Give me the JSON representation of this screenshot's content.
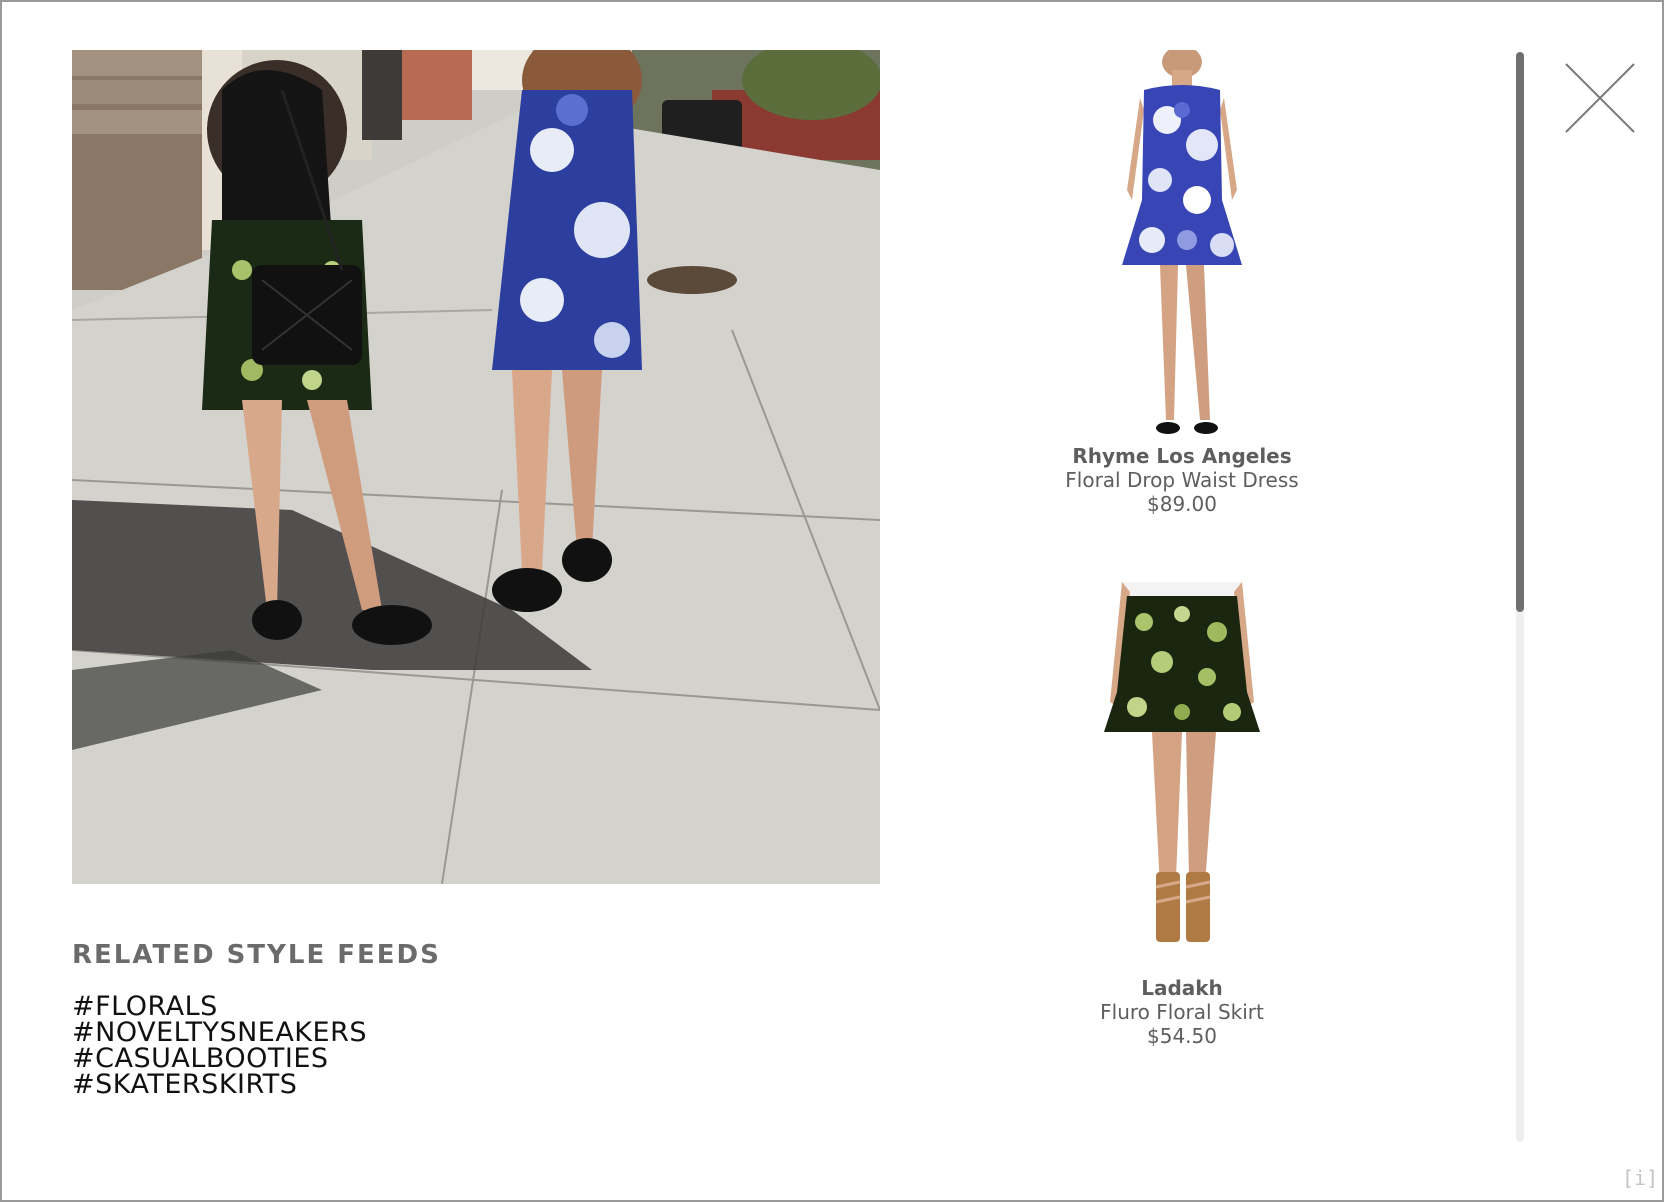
{
  "related": {
    "title": "RELATED STYLE FEEDS",
    "tags": [
      "#FLORALS",
      "#NOVELTYSNEAKERS",
      "#CASUALBOOTIES",
      "#SKATERSKIRTS"
    ]
  },
  "products": [
    {
      "brand": "Rhyme Los Angeles",
      "name": "Floral Drop Waist Dress",
      "price": "$89.00"
    },
    {
      "brand": "Ladakh",
      "name": "Fluro Floral Skirt",
      "price": "$54.50"
    }
  ],
  "info_label": "[i]",
  "icons": {
    "close": "close-icon",
    "info": "info-icon"
  },
  "colors": {
    "heading": "#6b6b6b",
    "tag_text": "#111111",
    "product_text": "#5e5e5e",
    "scroll_thumb": "#6f6f6f",
    "scroll_track": "#efefef",
    "border": "#9a9a9a"
  },
  "scroll_position": 0.0
}
